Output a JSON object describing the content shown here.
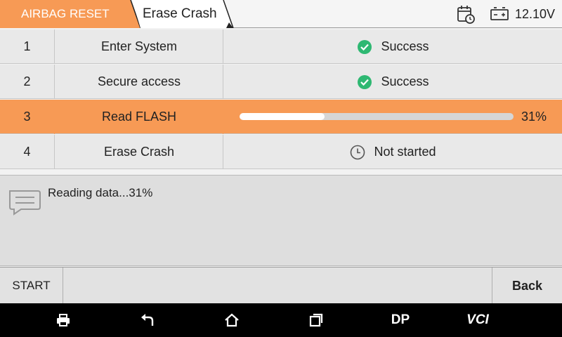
{
  "header": {
    "breadcrumb": [
      "AIRBAG RESET",
      "Erase Crash"
    ],
    "voltage": "12.10V",
    "accent_color": "#f79a55"
  },
  "steps": [
    {
      "num": "1",
      "name": "Enter System",
      "status": "Success",
      "state": "success"
    },
    {
      "num": "2",
      "name": "Secure access",
      "status": "Success",
      "state": "success"
    },
    {
      "num": "3",
      "name": "Read FLASH",
      "status": "",
      "state": "in-progress",
      "progress_percent": 31,
      "progress_label": "31%"
    },
    {
      "num": "4",
      "name": "Erase Crash",
      "status": "Not started",
      "state": "pending"
    }
  ],
  "message": {
    "text": "Reading data...31%"
  },
  "actions": {
    "start_label": "START",
    "back_label": "Back"
  },
  "navbar": {
    "dp_label": "DP",
    "vci_label": "VCI"
  }
}
